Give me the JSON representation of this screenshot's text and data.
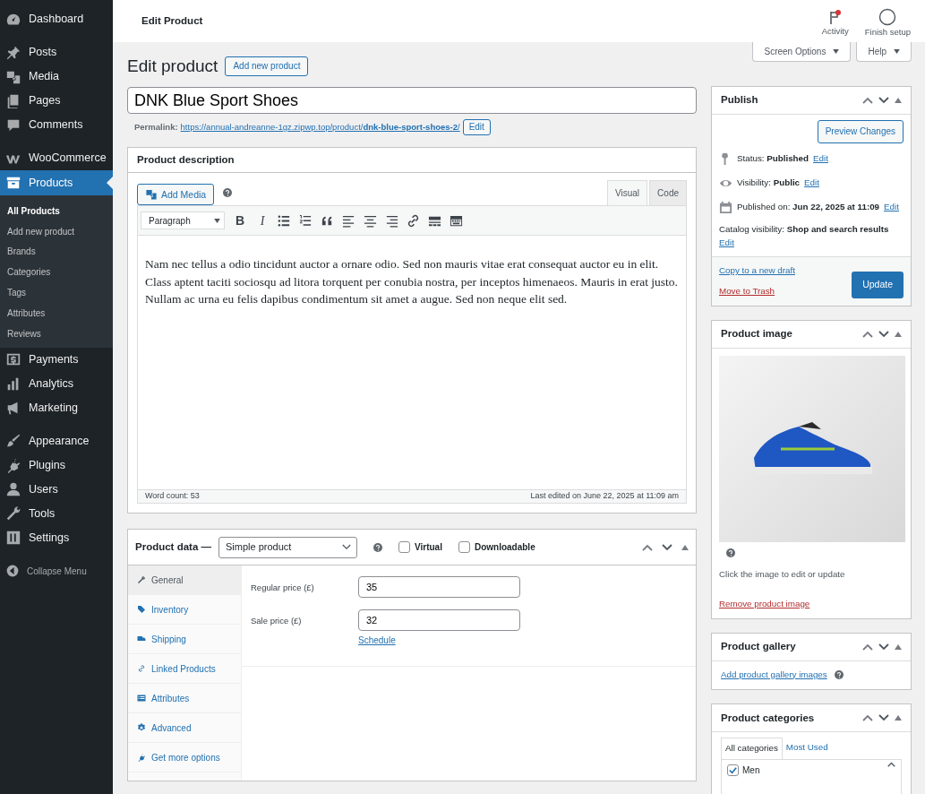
{
  "sidebar": {
    "groups": [
      [
        {
          "label": "Dashboard",
          "selected": false
        }
      ],
      [
        {
          "label": "Posts",
          "selected": false
        },
        {
          "label": "Media",
          "selected": false
        },
        {
          "label": "Pages",
          "selected": false
        },
        {
          "label": "Comments",
          "selected": false
        }
      ],
      [
        {
          "label": "WooCommerce",
          "selected": false
        },
        {
          "label": "Products",
          "selected": true,
          "submenu": [
            {
              "label": "All Products",
              "selected": true
            },
            {
              "label": "Add new product",
              "selected": false
            },
            {
              "label": "Brands",
              "selected": false
            },
            {
              "label": "Categories",
              "selected": false
            },
            {
              "label": "Tags",
              "selected": false
            },
            {
              "label": "Attributes",
              "selected": false
            },
            {
              "label": "Reviews",
              "selected": false
            }
          ]
        },
        {
          "label": "Payments",
          "selected": false
        },
        {
          "label": "Analytics",
          "selected": false
        },
        {
          "label": "Marketing",
          "selected": false
        }
      ],
      [
        {
          "label": "Appearance",
          "selected": false
        },
        {
          "label": "Plugins",
          "selected": false
        },
        {
          "label": "Users",
          "selected": false
        },
        {
          "label": "Tools",
          "selected": false
        },
        {
          "label": "Settings",
          "selected": false
        }
      ]
    ],
    "collapse": "Collapse Menu"
  },
  "topbar": {
    "title": "Edit Product",
    "actions": [
      {
        "label": "Activity",
        "unread": true
      },
      {
        "label": "Finish setup",
        "unread": false
      }
    ]
  },
  "screen_tabs": [
    "Screen Options",
    "Help"
  ],
  "heading": "Edit product",
  "add_new": "Add new product",
  "title_value": "DNK Blue Sport Shoes",
  "permalink": {
    "label": "Permalink:",
    "url": "https://annual-andreanne-1gz.zipwp.top/product/**dnk-blue-sport-shoes-2**/",
    "edit": "Edit"
  },
  "description": {
    "title": "Product description",
    "add_media": "Add Media",
    "tabs": [
      {
        "label": "Visual",
        "selected": true
      },
      {
        "label": "Code",
        "selected": false
      }
    ],
    "format": "Paragraph",
    "format_buttons": [
      "B",
      "I"
    ],
    "content": "Nam nec tellus a odio tincidunt auctor a ornare odio. Sed non mauris vitae erat consequat auctor eu in elit. Class aptent taciti sociosqu ad litora torquent per conubia nostra, per inceptos himenaeos. Mauris in erat justo. Nullam ac urna eu felis dapibus condimentum sit amet a augue. Sed non neque elit sed.",
    "word_count": "Word count: 53",
    "last_edited": "Last edited on June 22, 2025 at 11:09 am"
  },
  "product_data": {
    "title": "Product data —",
    "type": "Simple product",
    "options": [
      {
        "label": "Virtual",
        "checked": false
      },
      {
        "label": "Downloadable",
        "checked": false
      }
    ],
    "tabs": [
      {
        "label": "General",
        "selected": true
      },
      {
        "label": "Inventory",
        "selected": false
      },
      {
        "label": "Shipping",
        "selected": false
      },
      {
        "label": "Linked Products",
        "selected": false
      },
      {
        "label": "Attributes",
        "selected": false
      },
      {
        "label": "Advanced",
        "selected": false
      },
      {
        "label": "Get more options",
        "selected": false
      }
    ],
    "fields": [
      {
        "label": "Regular price (£)",
        "value": "35"
      },
      {
        "label": "Sale price (£)",
        "value": "32",
        "link": "Schedule"
      }
    ]
  },
  "publish": {
    "title": "Publish",
    "preview": "Preview Changes",
    "rows": [
      {
        "text": "Status: **Published**",
        "edit": "Edit"
      },
      {
        "text": "Visibility: **Public**",
        "edit": "Edit"
      },
      {
        "text": "Published on: **Jun 22, 2025 at 11:09**",
        "edit": "Edit"
      }
    ],
    "catalog": {
      "text": "Catalog visibility: **Shop and search results**",
      "edit": "Edit"
    },
    "copy": "Copy to a new draft",
    "trash": "Move to Trash",
    "update": "Update"
  },
  "product_image": {
    "title": "Product image",
    "hint": "Click the image to edit or update",
    "remove": "Remove product image"
  },
  "gallery": {
    "title": "Product gallery",
    "add": "Add product gallery images"
  },
  "categories": {
    "title": "Product categories",
    "tabs": [
      {
        "label": "All categories",
        "selected": true
      },
      {
        "label": "Most Used",
        "selected": false
      }
    ],
    "items": [
      {
        "label": "Men",
        "checked": true
      }
    ]
  }
}
